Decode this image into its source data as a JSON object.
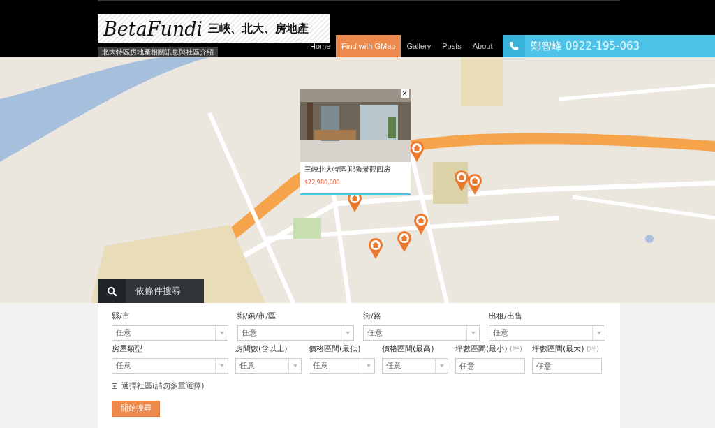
{
  "header": {
    "logo": {
      "script": "BetaFundi",
      "subtitle": "三峽、北大、房地產"
    },
    "tagline": "北大特區房地產相關訊息與社區介紹"
  },
  "nav": [
    {
      "label": "Home",
      "selected": false
    },
    {
      "label": "Find with GMap",
      "selected": true
    },
    {
      "label": "Gallery",
      "selected": false
    },
    {
      "label": "Posts",
      "selected": false
    },
    {
      "label": "About",
      "selected": false
    }
  ],
  "contact": {
    "text": "鄭智峰 0922-195-063"
  },
  "map": {
    "popup": {
      "title": "三峽北大特區-耶魯景觀四房",
      "price": "$22,980,000",
      "close": "×"
    },
    "markers": [
      {
        "kind": "house"
      },
      {
        "kind": "house"
      },
      {
        "kind": "house"
      },
      {
        "kind": "house"
      },
      {
        "kind": "house"
      },
      {
        "kind": "house"
      },
      {
        "kind": "house"
      }
    ]
  },
  "search": {
    "tab": "依條件搜尋",
    "fields": [
      {
        "label": "縣/市",
        "kind": "select",
        "value": "任意"
      },
      {
        "label": "鄉/鎮/市/區",
        "kind": "select",
        "value": "任意"
      },
      {
        "label": "街/路",
        "kind": "select",
        "value": "任意"
      },
      {
        "label": "出租/出售",
        "kind": "select",
        "value": "任意"
      },
      {
        "label": "房屋類型",
        "kind": "select",
        "value": "任意"
      },
      {
        "label": "房間數(含以上)",
        "kind": "select",
        "value": "任意"
      },
      {
        "label": "價格區間(最低)",
        "kind": "select",
        "value": "任意"
      },
      {
        "label": "價格區間(最高)",
        "kind": "select",
        "value": "任意"
      },
      {
        "label": "坪數區間(最小)",
        "unit": "(坪)",
        "kind": "input",
        "value": "任意"
      },
      {
        "label": "坪數區間(最大)",
        "unit": "(坪)",
        "kind": "input",
        "value": "任意"
      }
    ],
    "community": {
      "label": "選擇社區(請勿多重選擇)",
      "expanded": false
    },
    "button": "開始搜尋"
  }
}
